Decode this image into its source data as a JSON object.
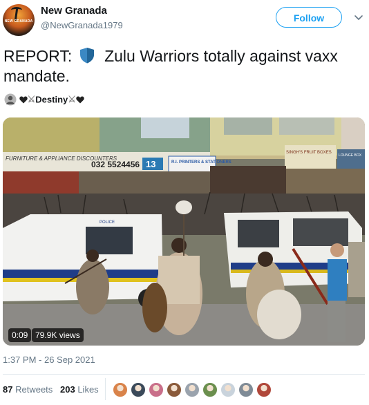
{
  "header": {
    "display_name": "New Granada",
    "handle": "@NewGranada1979",
    "follow_label": "Follow",
    "avatar_text": "NEW GRANADA"
  },
  "tweet": {
    "text_before": "REPORT:",
    "text_after": "Zulu Warriors totally against vaxx mandate."
  },
  "reply_tag": {
    "name": "Destiny"
  },
  "video": {
    "duration": "0:09",
    "views": "79.9K views",
    "signs": {
      "furniture": "FURNITURE & APPLIANCE DISCOUNTERS",
      "phone": "032 5524456",
      "phone_box": "13",
      "printers": "R.I. PRINTERS & STATIONERS",
      "fruit": "SINGH'S FRUIT BOXES",
      "lounge": "LOUNGE BOX",
      "police": "POLICE"
    }
  },
  "timestamp": "1:37 PM - 26 Sep 2021",
  "stats": {
    "retweets_count": "87",
    "retweets_label": "Retweets",
    "likes_count": "203",
    "likes_label": "Likes"
  },
  "colors": {
    "accent": "#1da1f2",
    "secondary_text": "#657786",
    "divider": "#e1e8ed"
  },
  "likers": [
    {
      "name": "liker-avatar-1",
      "color": "#d9834a"
    },
    {
      "name": "liker-avatar-2",
      "color": "#3b4a5a"
    },
    {
      "name": "liker-avatar-3",
      "color": "#c96f8a"
    },
    {
      "name": "liker-avatar-4",
      "color": "#8a5a3a"
    },
    {
      "name": "liker-avatar-5",
      "color": "#9aa3ad"
    },
    {
      "name": "liker-avatar-6",
      "color": "#6b8f4e"
    },
    {
      "name": "liker-avatar-7",
      "color": "#c9d3dc"
    },
    {
      "name": "liker-avatar-8",
      "color": "#7f8b96"
    },
    {
      "name": "liker-avatar-9",
      "color": "#b0473a"
    }
  ]
}
